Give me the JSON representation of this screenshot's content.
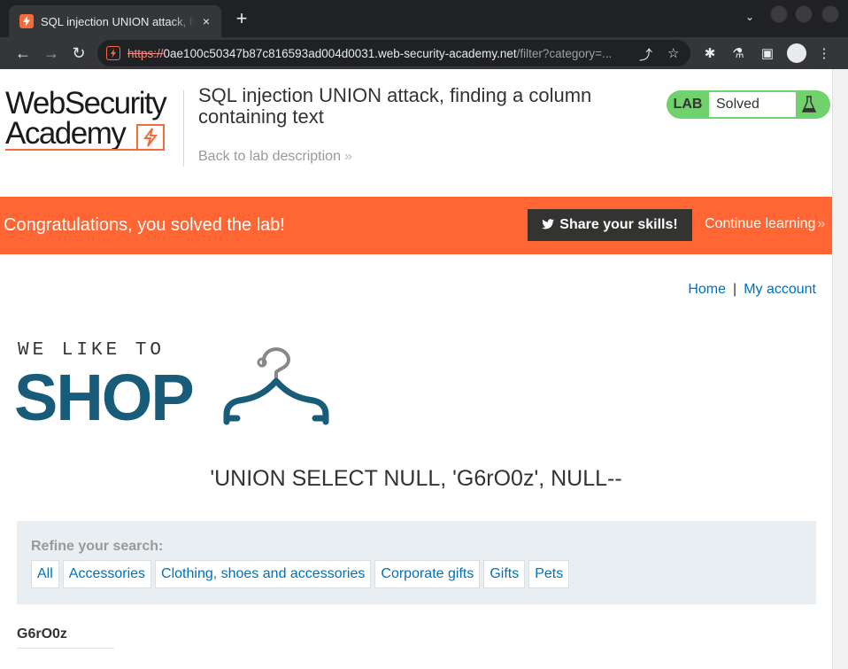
{
  "browser": {
    "tab_title": "SQL injection UNION attack, finding a column containing text",
    "url_scheme": "https://",
    "url_host": "0ae100c50347b87c816593ad004d0031.web-security-academy.net",
    "url_path": "/filter?category=...",
    "new_tab_symbol": "+",
    "close_symbol": "×"
  },
  "header": {
    "logo_line1": "WebSecurity",
    "logo_line2": "Academy",
    "lab_title": "SQL injection UNION attack, finding a column containing text",
    "back_link": "Back to lab description",
    "lab_tag": "LAB",
    "lab_status": "Solved",
    "status_color": "#70d16d"
  },
  "notification": {
    "message": "Congratulations, you solved the lab!",
    "share_label": "Share your skills!",
    "continue_label": "Continue learning",
    "banner_color": "#ff6633"
  },
  "nav": {
    "home": "Home",
    "separator": "|",
    "account": "My account"
  },
  "shop_logo": {
    "tagline": "WE LIKE TO",
    "word": "SHOP",
    "color": "#185c7a"
  },
  "search": {
    "heading": "'UNION SELECT NULL, 'G6rO0z', NULL--"
  },
  "refine": {
    "label": "Refine your search:",
    "filters": [
      "All",
      "Accessories",
      "Clothing, shoes and accessories",
      "Corporate gifts",
      "Gifts",
      "Pets"
    ]
  },
  "results": {
    "first_title": "G6rO0z"
  }
}
